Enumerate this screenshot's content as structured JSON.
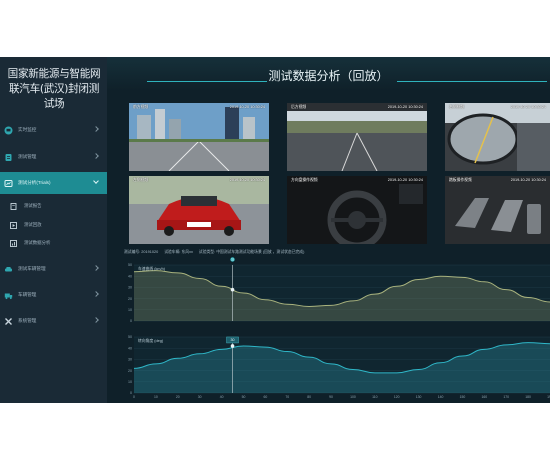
{
  "app": {
    "brand": "国家新能源与智能网联汽车(武汉)封闭测试场",
    "page_title": "测试数据分析（回放）"
  },
  "sidebar": {
    "items": [
      {
        "label": "实时监控",
        "icon": "monitor-icon",
        "active": false
      },
      {
        "label": "测试管理",
        "icon": "clipboard-icon",
        "active": false
      },
      {
        "label": "测试分析(Trials)",
        "icon": "analysis-icon",
        "active": true
      },
      {
        "label": "测试车辆管理",
        "icon": "car-icon",
        "active": false
      },
      {
        "label": "车辆管理",
        "icon": "truck-icon",
        "active": false
      },
      {
        "label": "系统管理",
        "icon": "tools-icon",
        "active": false
      }
    ],
    "subitems": [
      {
        "label": "测试报告",
        "icon": "report-icon"
      },
      {
        "label": "测试回放",
        "icon": "replay-icon"
      },
      {
        "label": "测试数据分析",
        "icon": "chart-icon"
      }
    ]
  },
  "cameras": [
    {
      "label": "前方视频",
      "time": "2019-10-20 10:30:24",
      "scene": "city-road"
    },
    {
      "label": "后方视频",
      "time": "2019-10-20 10:30:24",
      "scene": "rear-road"
    },
    {
      "label": "右侧视频",
      "time": "2019-10-20 10:30:24",
      "scene": "side-mirror"
    },
    {
      "label": "左侧视频",
      "time": "2019-10-20 10:30:24",
      "scene": "red-car"
    },
    {
      "label": "方向盘操作视频",
      "time": "2019-10-20 10:30:24",
      "scene": "steering"
    },
    {
      "label": "踏板操作视频",
      "time": "2019-10-20 10:30:24",
      "scene": "pedals"
    }
  ],
  "chart_header": [
    "测试编号: 20191020",
    "试验车辆: 东风xx",
    "试验类型: 中国测试车路测试功能场景 (回放 ，测试状态已完成)"
  ],
  "playhead": {
    "label": "32"
  },
  "chart_data": [
    {
      "type": "area",
      "title": "车速曲线 (km/h)",
      "x": [
        0,
        10,
        20,
        30,
        40,
        50,
        60,
        70,
        80,
        90,
        100,
        110,
        120,
        130,
        140,
        150,
        160,
        170,
        180,
        190
      ],
      "xlim": [
        0,
        190
      ],
      "ylim": [
        0,
        50
      ],
      "yticks": [
        0,
        10,
        20,
        30,
        40,
        50
      ],
      "series": [
        {
          "values": [
            44,
            45,
            43,
            38,
            31,
            25,
            19,
            15,
            13,
            14,
            18,
            24,
            31,
            37,
            40,
            39,
            35,
            28,
            21,
            17
          ]
        }
      ],
      "marker": {
        "x": 45,
        "y": 28,
        "label": ""
      },
      "color": "#7e8a63"
    },
    {
      "type": "area",
      "title": "转向角度 (deg)",
      "x": [
        0,
        10,
        20,
        30,
        40,
        50,
        60,
        70,
        80,
        90,
        100,
        110,
        120,
        130,
        140,
        150,
        160,
        170,
        180,
        190
      ],
      "xlim": [
        0,
        190
      ],
      "ylim": [
        0,
        50
      ],
      "yticks": [
        0,
        10,
        20,
        30,
        40,
        50
      ],
      "xticks": [
        "0",
        "10",
        "20",
        "30",
        "40",
        "50",
        "60",
        "70",
        "80",
        "90",
        "100",
        "110",
        "120",
        "130",
        "140",
        "150",
        "160",
        "170",
        "180",
        "190"
      ],
      "series": [
        {
          "values": [
            22,
            26,
            31,
            35,
            39,
            42,
            41,
            37,
            32,
            26,
            21,
            18,
            18,
            21,
            27,
            33,
            39,
            43,
            45,
            44
          ]
        }
      ],
      "marker": {
        "x": 45,
        "y": 42,
        "label": "30"
      },
      "color": "#2a8fa0"
    }
  ]
}
